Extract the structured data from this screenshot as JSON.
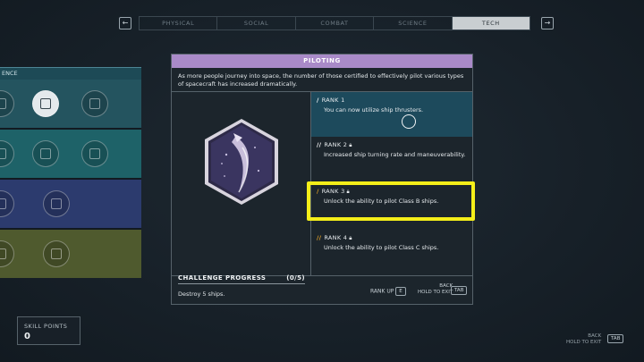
{
  "tabs": {
    "prev_key": "←",
    "next_key": "→",
    "items": [
      "PHYSICAL",
      "SOCIAL",
      "COMBAT",
      "SCIENCE",
      "TECH"
    ],
    "active_index": 4
  },
  "left_column": {
    "header": "ENCE"
  },
  "panel": {
    "title": "PILOTING",
    "description": "As more people journey into space, the number of those certified to effectively pilot various types of spacecraft has increased dramatically.",
    "challenge": {
      "title": "CHALLENGE PROGRESS",
      "count": "(0/5)",
      "task": "Destroy 5 ships."
    },
    "ranks": [
      {
        "label": "RANK 1",
        "text": "You can now utilize ship thrusters.",
        "locked": false
      },
      {
        "label": "RANK 2",
        "text": "Increased ship turning rate and maneuverability.",
        "locked": true
      },
      {
        "label": "RANK 3",
        "text": "Unlock the ability to pilot Class B ships.",
        "locked": true
      },
      {
        "label": "RANK 4",
        "text": "Unlock the ability to pilot Class C ships.",
        "locked": true
      }
    ],
    "footer": {
      "rank_up_label": "RANK UP",
      "rank_up_key": "E",
      "back_label": "BACK",
      "hold_label": "HOLD TO EXIT",
      "back_key": "TAB"
    }
  },
  "skill_points": {
    "label": "SKILL POINTS",
    "value": "0"
  },
  "corner": {
    "back_label": "BACK",
    "hold_label": "HOLD TO EXIT",
    "back_key": "TAB"
  },
  "colors": {
    "title_bar": "#a98ac8",
    "highlight": "#f4ee19",
    "rank_active": "#1d4a5c",
    "rank_bar_gold": "#e3a126"
  }
}
